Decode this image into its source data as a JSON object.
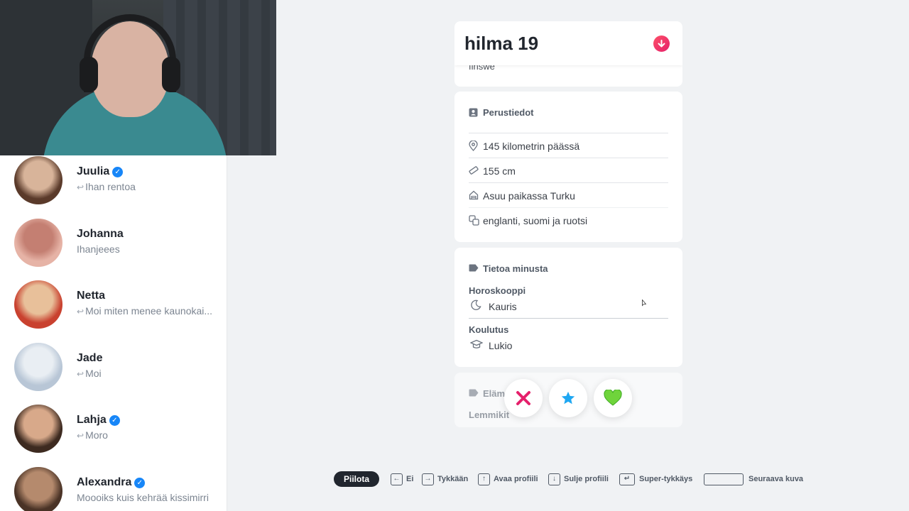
{
  "profile": {
    "name_age": "hilma 19",
    "bio_tail": "finswe",
    "basics": {
      "title": "Perustiedot",
      "rows": [
        {
          "icon": "location-pin-icon",
          "text": "145 kilometrin päässä"
        },
        {
          "icon": "ruler-icon",
          "text": "155 cm"
        },
        {
          "icon": "home-icon",
          "text": "Asuu paikassa Turku"
        },
        {
          "icon": "language-icon",
          "text": "englanti, suomi ja ruotsi"
        }
      ]
    },
    "about": {
      "title": "Tietoa minusta",
      "items": [
        {
          "label": "Horoskooppi",
          "icon": "moon-icon",
          "value": "Kauris"
        },
        {
          "label": "Koulutus",
          "icon": "graduation-cap-icon",
          "value": "Lukio"
        }
      ]
    },
    "lifestyle": {
      "title_partial": "Elämä",
      "sub_partial": "Lemmikit"
    }
  },
  "matches": [
    {
      "name": "Juulia",
      "verified": true,
      "message": "Ihan rentoa",
      "replied": true,
      "colors": [
        "#5a3a2a",
        "#d8b49a"
      ]
    },
    {
      "name": "Johanna",
      "verified": false,
      "message": "Ihanjeees",
      "replied": false,
      "colors": [
        "#e6b3a6",
        "#c47f72"
      ]
    },
    {
      "name": "Netta",
      "verified": false,
      "message": "Moi miten menee kaunokai...",
      "replied": true,
      "colors": [
        "#c9412f",
        "#e8c09a"
      ]
    },
    {
      "name": "Jade",
      "verified": false,
      "message": "Moi",
      "replied": true,
      "colors": [
        "#b8c6d6",
        "#e9eef3"
      ]
    },
    {
      "name": "Lahja",
      "verified": true,
      "message": "Moro",
      "replied": true,
      "colors": [
        "#3d2a20",
        "#d8a98a"
      ]
    },
    {
      "name": "Alexandra",
      "verified": true,
      "message": "Moooiks kuis kehrää kissimirri",
      "replied": false,
      "colors": [
        "#4a3326",
        "#b58a6d"
      ]
    }
  ],
  "actions": [
    {
      "name": "nope-button",
      "icon": "x-icon",
      "color": "#e5206b"
    },
    {
      "name": "superlike-button",
      "icon": "star-icon",
      "color": "#1ea7f2"
    },
    {
      "name": "like-button",
      "icon": "heart-icon",
      "color": "#5bd039"
    }
  ],
  "shortcuts": {
    "hide": "Piilota",
    "items": [
      {
        "key": "←",
        "label": "Ei"
      },
      {
        "key": "→",
        "label": "Tykkään"
      },
      {
        "key": "↑",
        "label": "Avaa profiili"
      },
      {
        "key": "↓",
        "label": "Sulje profiili"
      },
      {
        "key": "↵",
        "label": "Super-tykkäys"
      },
      {
        "key": "",
        "label": "Seuraava kuva"
      }
    ]
  }
}
